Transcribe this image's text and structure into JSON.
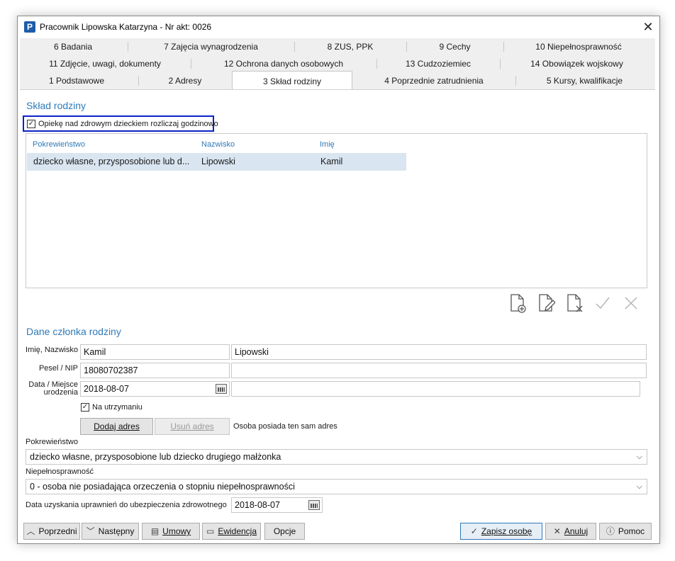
{
  "window": {
    "title": "Pracownik Lipowska Katarzyna - Nr akt: 0026",
    "app_icon_letter": "P"
  },
  "tabs": {
    "row1": [
      "6 Badania",
      "7 Zajęcia wynagrodzenia",
      "8 ZUS, PPK",
      "9 Cechy",
      "10 Niepełnosprawność"
    ],
    "row2": [
      "11 Zdjęcie, uwagi, dokumenty",
      "12 Ochrona danych osobowych",
      "13 Cudzoziemiec",
      "14 Obowiązek wojskowy"
    ],
    "row3": [
      "1 Podstawowe",
      "2 Adresy",
      "3 Skład rodziny",
      "4 Poprzednie zatrudnienia",
      "5 Kursy, kwalifikacje"
    ],
    "active": "3 Skład rodziny"
  },
  "family_section": {
    "title": "Skład rodziny",
    "hourly_care_checkbox": {
      "label": "Opiekę nad zdrowym dzieckiem rozliczaj godzinowo",
      "checked": true
    }
  },
  "family_table": {
    "columns": [
      "Pokrewieństwo",
      "Nazwisko",
      "Imię"
    ],
    "rows": [
      {
        "relation": "dziecko własne, przysposobione lub d...",
        "surname": "Lipowski",
        "name": "Kamil"
      }
    ]
  },
  "toolbar_icons": [
    "add-document-icon",
    "edit-document-icon",
    "delete-document-icon",
    "confirm-check-icon",
    "cancel-x-icon"
  ],
  "member_section": {
    "title": "Dane członka rodziny",
    "name_label": "Imię, Nazwisko",
    "first_name": "Kamil",
    "last_name": "Lipowski",
    "pesel_label": "Pesel / NIP",
    "pesel": "18080702387",
    "nip": "",
    "birth_label_line1": "Data / Miejsce",
    "birth_label_line2": "urodzenia",
    "birth_date": "2018-08-07",
    "birth_place": "",
    "dependent_checkbox": {
      "label": "Na utrzymaniu",
      "checked": true
    },
    "add_address_button": "Dodaj adres",
    "remove_address_button": "Usuń adres",
    "same_address_text": "Osoba posiada ten sam adres",
    "relation_label": "Pokrewieństwo",
    "relation_value": "dziecko własne, przysposobione lub dziecko drugiego małżonka",
    "disability_label": "Niepełnosprawność",
    "disability_value": "0 - osoba nie posiadająca orzeczenia o stopniu niepełnosprawności",
    "insurance_label": "Data uzyskania uprawnień do ubezpieczenia zdrowotnego",
    "insurance_date": "2018-08-07"
  },
  "footer": {
    "prev": "Poprzedni",
    "next": "Następny",
    "contracts": "Umowy",
    "records": "Ewidencja",
    "options": "Opcje",
    "save": "Zapisz osobę",
    "cancel": "Anuluj",
    "help": "Pomoc"
  }
}
